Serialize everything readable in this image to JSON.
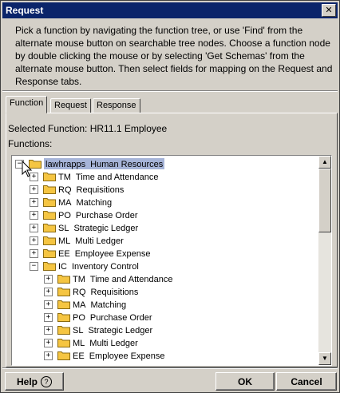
{
  "window": {
    "title": "Request",
    "close_glyph": "✕"
  },
  "instructions": "Pick a function by navigating the function tree, or use 'Find' from the alternate mouse button on searchable tree nodes. Choose a function node by double clicking the mouse or by selecting 'Get Schemas' from the alternate mouse button. Then select fields for mapping on the Request and Response tabs.",
  "tabs": [
    {
      "label": "Function",
      "active": true
    },
    {
      "label": "Request",
      "active": false
    },
    {
      "label": "Response",
      "active": false
    }
  ],
  "selected_function": "Selected Function: HR11.1  Employee",
  "functions_label": "Functions:",
  "tree": {
    "root": {
      "expander": "−",
      "code": "lawhrapps",
      "label": "Human Resources",
      "selected": true
    },
    "level1": [
      {
        "expander": "+",
        "code": "TM",
        "label": "Time and Attendance"
      },
      {
        "expander": "+",
        "code": "RQ",
        "label": "Requisitions"
      },
      {
        "expander": "+",
        "code": "MA",
        "label": "Matching"
      },
      {
        "expander": "+",
        "code": "PO",
        "label": "Purchase Order"
      },
      {
        "expander": "+",
        "code": "SL",
        "label": "Strategic Ledger"
      },
      {
        "expander": "+",
        "code": "ML",
        "label": "Multi Ledger"
      },
      {
        "expander": "+",
        "code": "EE",
        "label": "Employee Expense"
      },
      {
        "expander": "−",
        "code": "IC",
        "label": "Inventory Control"
      }
    ],
    "level2": [
      {
        "expander": "+",
        "code": "TM",
        "label": "Time and Attendance"
      },
      {
        "expander": "+",
        "code": "RQ",
        "label": "Requisitions"
      },
      {
        "expander": "+",
        "code": "MA",
        "label": "Matching"
      },
      {
        "expander": "+",
        "code": "PO",
        "label": "Purchase Order"
      },
      {
        "expander": "+",
        "code": "SL",
        "label": "Strategic Ledger"
      },
      {
        "expander": "+",
        "code": "ML",
        "label": "Multi Ledger"
      },
      {
        "expander": "+",
        "code": "EE",
        "label": "Employee Expense"
      }
    ]
  },
  "scrollbar": {
    "up_glyph": "▲",
    "down_glyph": "▼"
  },
  "buttons": {
    "help": "Help",
    "help_icon": "?",
    "ok": "OK",
    "cancel": "Cancel"
  },
  "colors": {
    "title_bar": "#0a246a",
    "selection": "#a6b4d8",
    "folder": "#f5c542"
  }
}
